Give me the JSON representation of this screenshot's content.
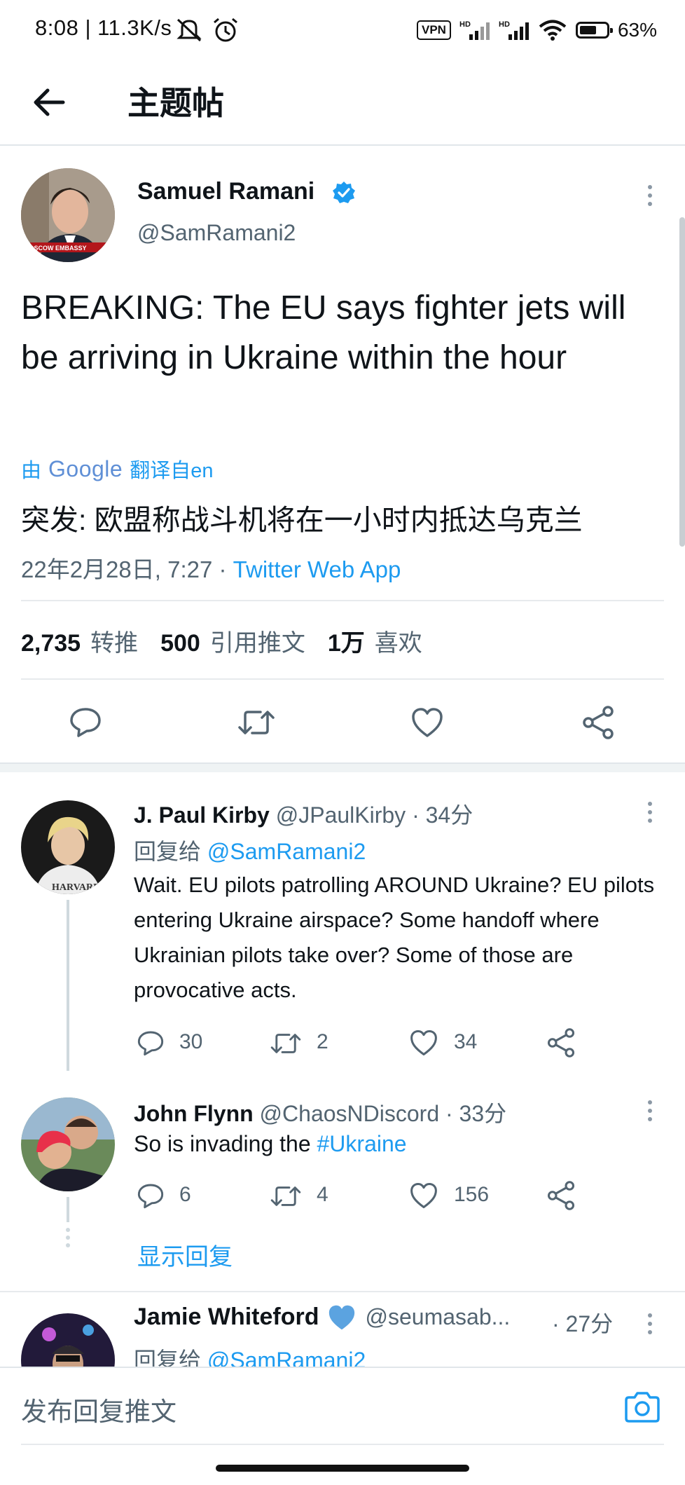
{
  "status_bar": {
    "time": "8:08 | 11.3K/s",
    "vpn": "VPN",
    "battery": "63%",
    "battery_level": 0.63
  },
  "header": {
    "title": "主题帖"
  },
  "tweet": {
    "author_name": "Samuel Ramani",
    "author_handle": "@SamRamani2",
    "text": "BREAKING: The EU says fighter jets will be arriving in Ukraine within the hour",
    "translate_prefix": "由",
    "translate_google": "Google",
    "translate_suffix": "翻译自en",
    "translation": "突发: 欧盟称战斗机将在一小时内抵达乌克兰",
    "timestamp": "22年2月28日, 7:27 · ",
    "source": "Twitter Web App",
    "stats": {
      "retweets": "2,735",
      "retweets_label": "转推",
      "quotes": "500",
      "quotes_label": "引用推文",
      "likes": "1万",
      "likes_label": "喜欢"
    }
  },
  "replies": [
    {
      "name": "J. Paul Kirby",
      "handle": "@JPaulKirby · 34分",
      "reply_to_prefix": "回复给",
      "reply_to": "@SamRamani2",
      "text": "Wait. EU pilots patrolling AROUND Ukraine? EU pilots entering Ukraine airspace? Some handoff where Ukrainian pilots take over? Some of those are provocative acts.",
      "replies": "30",
      "retweets": "2",
      "likes": "34"
    },
    {
      "name": "John Flynn",
      "handle": "@ChaosNDiscord · 33分",
      "text_prefix": "So is invading the ",
      "hashtag": "#Ukraine",
      "replies": "6",
      "retweets": "4",
      "likes": "156"
    },
    {
      "name": "Jamie Whiteford",
      "handle": "@seumasab...",
      "time": "· 27分",
      "reply_to_prefix": "回复给",
      "reply_to": "@SamRamani2"
    }
  ],
  "show_replies": "显示回复",
  "compose": {
    "placeholder": "发布回复推文"
  },
  "colors": {
    "accent": "#1d9bf0",
    "secondary_text": "#536471",
    "verified": "#1d9bf0"
  }
}
